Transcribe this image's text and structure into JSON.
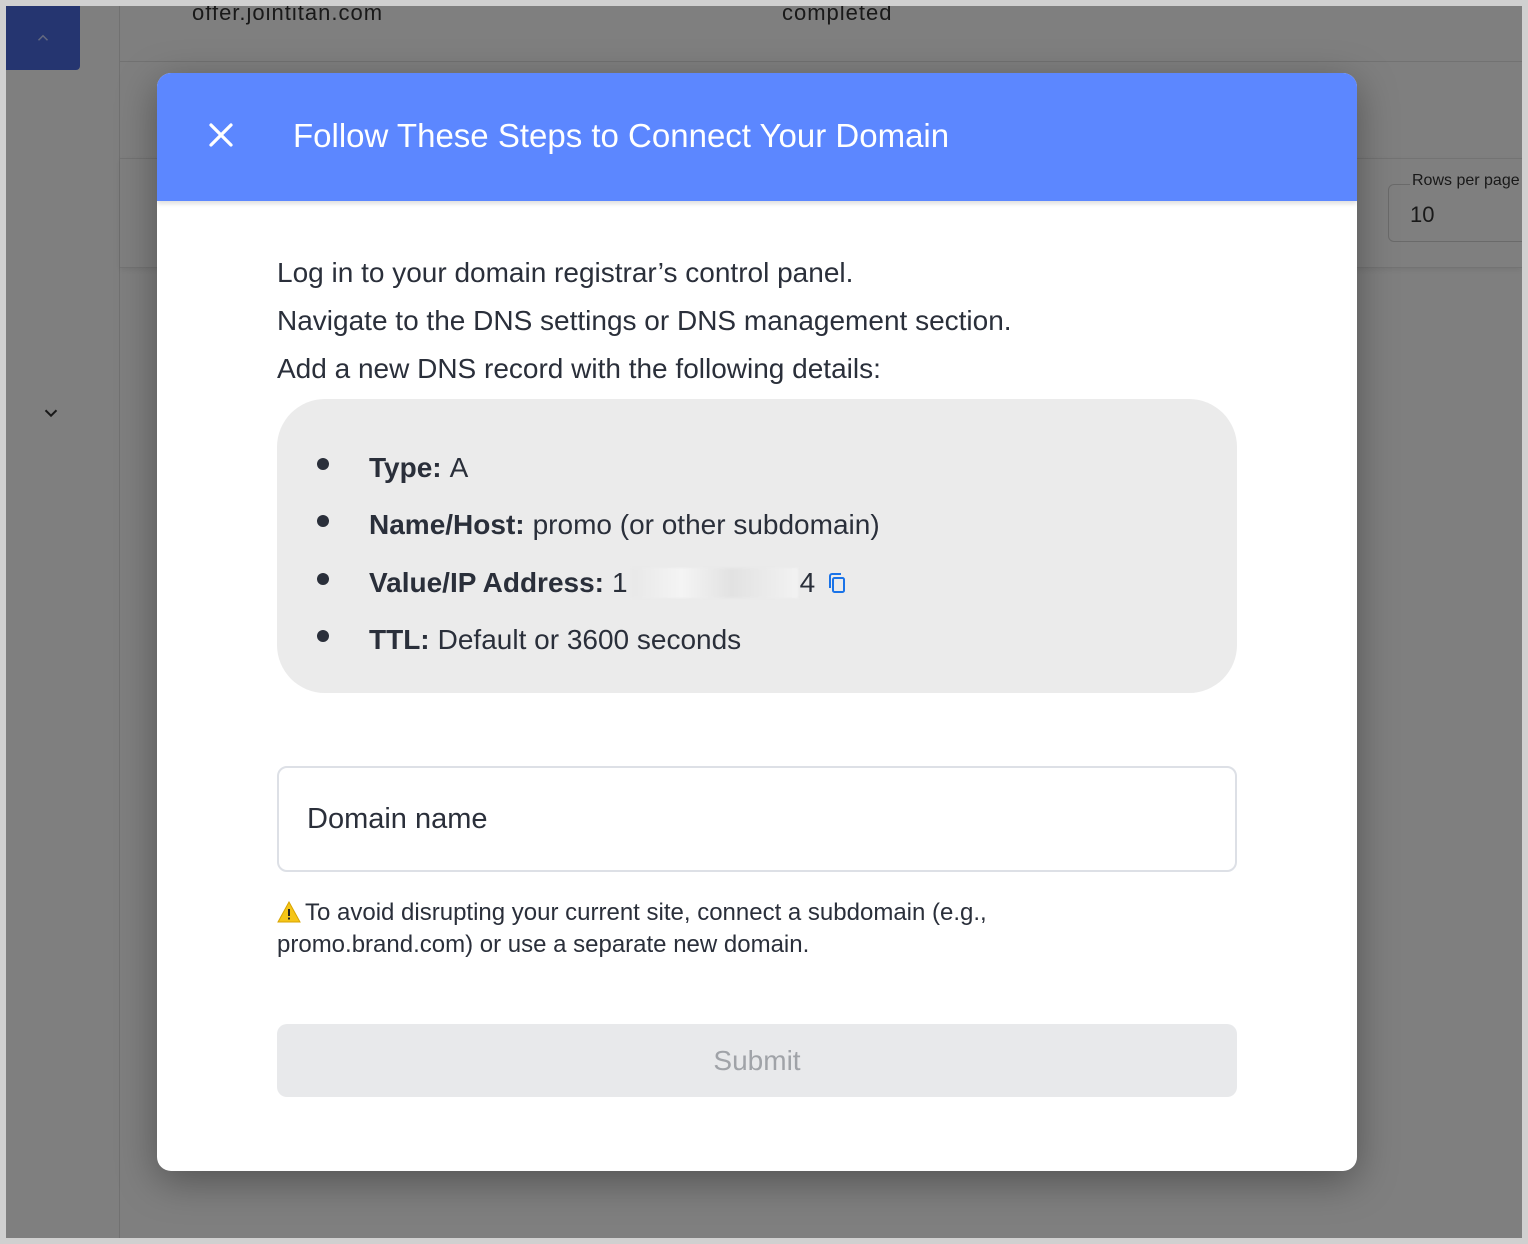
{
  "background": {
    "table_row": {
      "domain": "offer.jointitan.com",
      "status": "completed"
    },
    "pagination": {
      "rows_per_page_label": "Rows per page",
      "rows_per_page_value": "10"
    }
  },
  "modal": {
    "title": "Follow These Steps to Connect Your Domain",
    "steps": [
      "Log in to your domain registrar’s control panel.",
      "Navigate to the DNS settings or DNS management section.",
      "Add a new DNS record with the following details:"
    ],
    "record": {
      "type_label": "Type:",
      "type_value": "A",
      "name_label": "Name/Host:",
      "name_value": "promo (or other subdomain)",
      "value_label": "Value/IP Address:",
      "value_prefix": "1",
      "value_suffix": "4",
      "ttl_label": "TTL:",
      "ttl_value": "Default or 3600 seconds"
    },
    "domain_input": {
      "placeholder": "Domain name",
      "value": ""
    },
    "warning": "To avoid disrupting your current site, connect a subdomain (e.g., promo.brand.com) or use a separate new domain.",
    "submit_label": "Submit"
  },
  "colors": {
    "header": "#5c87ff",
    "accent": "#4a6be0",
    "copy_icon": "#1a73e8",
    "warning_icon": "#f5c518"
  }
}
